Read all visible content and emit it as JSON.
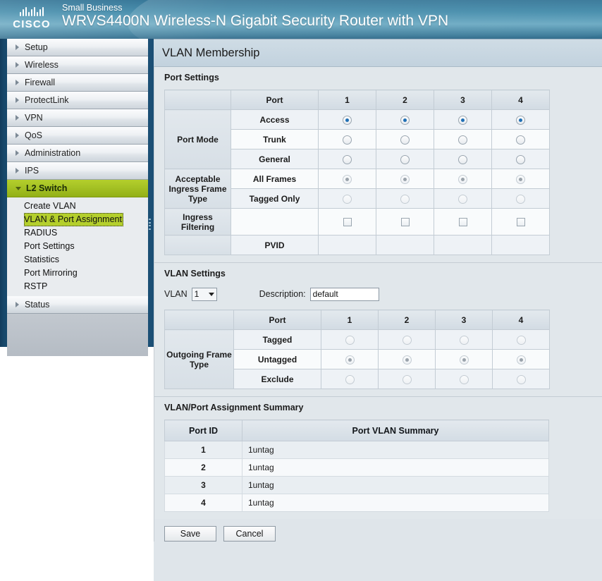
{
  "header": {
    "logo_text": "CISCO",
    "small_text": "Small Business",
    "model_title": "WRVS4400N Wireless-N Gigabit Security Router with VPN"
  },
  "sidebar": {
    "items": [
      {
        "label": "Setup"
      },
      {
        "label": "Wireless"
      },
      {
        "label": "Firewall"
      },
      {
        "label": "ProtectLink"
      },
      {
        "label": "VPN"
      },
      {
        "label": "QoS"
      },
      {
        "label": "Administration"
      },
      {
        "label": "IPS"
      },
      {
        "label": "L2 Switch"
      },
      {
        "label": "Status"
      }
    ],
    "l2_switch_submenu": [
      {
        "label": "Create VLAN"
      },
      {
        "label": "VLAN & Port Assignment"
      },
      {
        "label": "RADIUS"
      },
      {
        "label": "Port Settings"
      },
      {
        "label": "Statistics"
      },
      {
        "label": "Port Mirroring"
      },
      {
        "label": "RSTP"
      }
    ],
    "selected_submenu": "VLAN & Port Assignment",
    "expanded_item": "L2 Switch",
    "highlight_color": "#b4cf2c"
  },
  "page": {
    "title": "VLAN Membership"
  },
  "port_settings": {
    "section_title": "Port Settings",
    "port_header": "Port",
    "ports": [
      "1",
      "2",
      "3",
      "4"
    ],
    "groups": [
      {
        "label": "Port Mode",
        "rows": [
          {
            "label": "Access",
            "type": "radio",
            "selected": [
              true,
              true,
              true,
              true
            ],
            "disabled": false
          },
          {
            "label": "Trunk",
            "type": "radio",
            "selected": [
              false,
              false,
              false,
              false
            ],
            "disabled": false
          },
          {
            "label": "General",
            "type": "radio",
            "selected": [
              false,
              false,
              false,
              false
            ],
            "disabled": false
          }
        ]
      },
      {
        "label": "Acceptable Ingress Frame Type",
        "rows": [
          {
            "label": "All Frames",
            "type": "radio",
            "selected": [
              true,
              true,
              true,
              true
            ],
            "disabled": true
          },
          {
            "label": "Tagged Only",
            "type": "radio",
            "selected": [
              false,
              false,
              false,
              false
            ],
            "disabled": true
          }
        ]
      },
      {
        "label": "Ingress Filtering",
        "rows": [
          {
            "label": "",
            "type": "checkbox",
            "checked": [
              false,
              false,
              false,
              false
            ],
            "disabled": true
          }
        ]
      },
      {
        "label": "",
        "rows": [
          {
            "label": "PVID",
            "type": "text",
            "values": [
              "",
              "",
              "",
              ""
            ],
            "disabled": true
          }
        ]
      }
    ]
  },
  "vlan_settings": {
    "section_title": "VLAN Settings",
    "vlan_label": "VLAN",
    "vlan_selected": "1",
    "vlan_options": [
      "1"
    ],
    "description_label": "Description:",
    "description_value": "default",
    "port_header": "Port",
    "ports": [
      "1",
      "2",
      "3",
      "4"
    ],
    "group_label": "Outgoing Frame Type",
    "rows": [
      {
        "label": "Tagged",
        "selected": [
          false,
          false,
          false,
          false
        ],
        "disabled": true
      },
      {
        "label": "Untagged",
        "selected": [
          true,
          true,
          true,
          true
        ],
        "disabled": true
      },
      {
        "label": "Exclude",
        "selected": [
          false,
          false,
          false,
          false
        ],
        "disabled": true
      }
    ]
  },
  "summary": {
    "section_title": "VLAN/Port Assignment Summary",
    "columns": [
      "Port ID",
      "Port VLAN Summary"
    ],
    "rows": [
      {
        "port_id": "1",
        "vlan_summary": "1untag"
      },
      {
        "port_id": "2",
        "vlan_summary": "1untag"
      },
      {
        "port_id": "3",
        "vlan_summary": "1untag"
      },
      {
        "port_id": "4",
        "vlan_summary": "1untag"
      }
    ]
  },
  "buttons": {
    "save": "Save",
    "cancel": "Cancel"
  }
}
